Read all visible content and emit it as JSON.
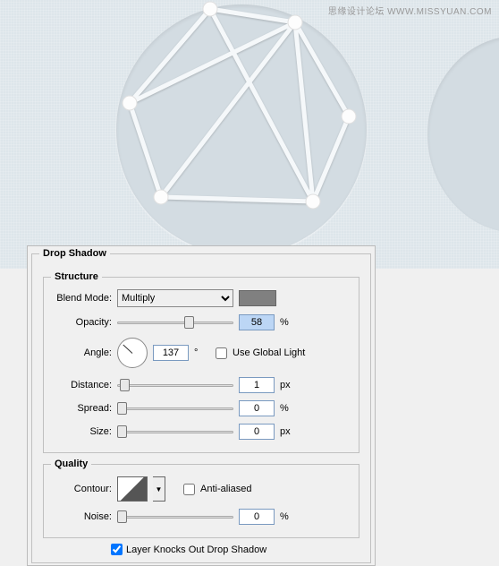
{
  "watermark": "思缘设计论坛  WWW.MISSYUAN.COM",
  "panel": {
    "title": "Drop Shadow",
    "structure": {
      "legend": "Structure",
      "blend_mode_label": "Blend Mode:",
      "blend_mode_value": "Multiply",
      "color_swatch": "#808080",
      "opacity_label": "Opacity:",
      "opacity_value": "58",
      "opacity_unit": "%",
      "angle_label": "Angle:",
      "angle_value": "137",
      "angle_unit": "°",
      "use_global_light_label": "Use Global Light",
      "use_global_light_checked": false,
      "distance_label": "Distance:",
      "distance_value": "1",
      "distance_unit": "px",
      "spread_label": "Spread:",
      "spread_value": "0",
      "spread_unit": "%",
      "size_label": "Size:",
      "size_value": "0",
      "size_unit": "px"
    },
    "quality": {
      "legend": "Quality",
      "contour_label": "Contour:",
      "anti_aliased_label": "Anti-aliased",
      "anti_aliased_checked": false,
      "noise_label": "Noise:",
      "noise_value": "0",
      "noise_unit": "%"
    },
    "footer": {
      "knocks_out_label": "Layer Knocks Out Drop Shadow",
      "knocks_out_checked": true
    }
  }
}
